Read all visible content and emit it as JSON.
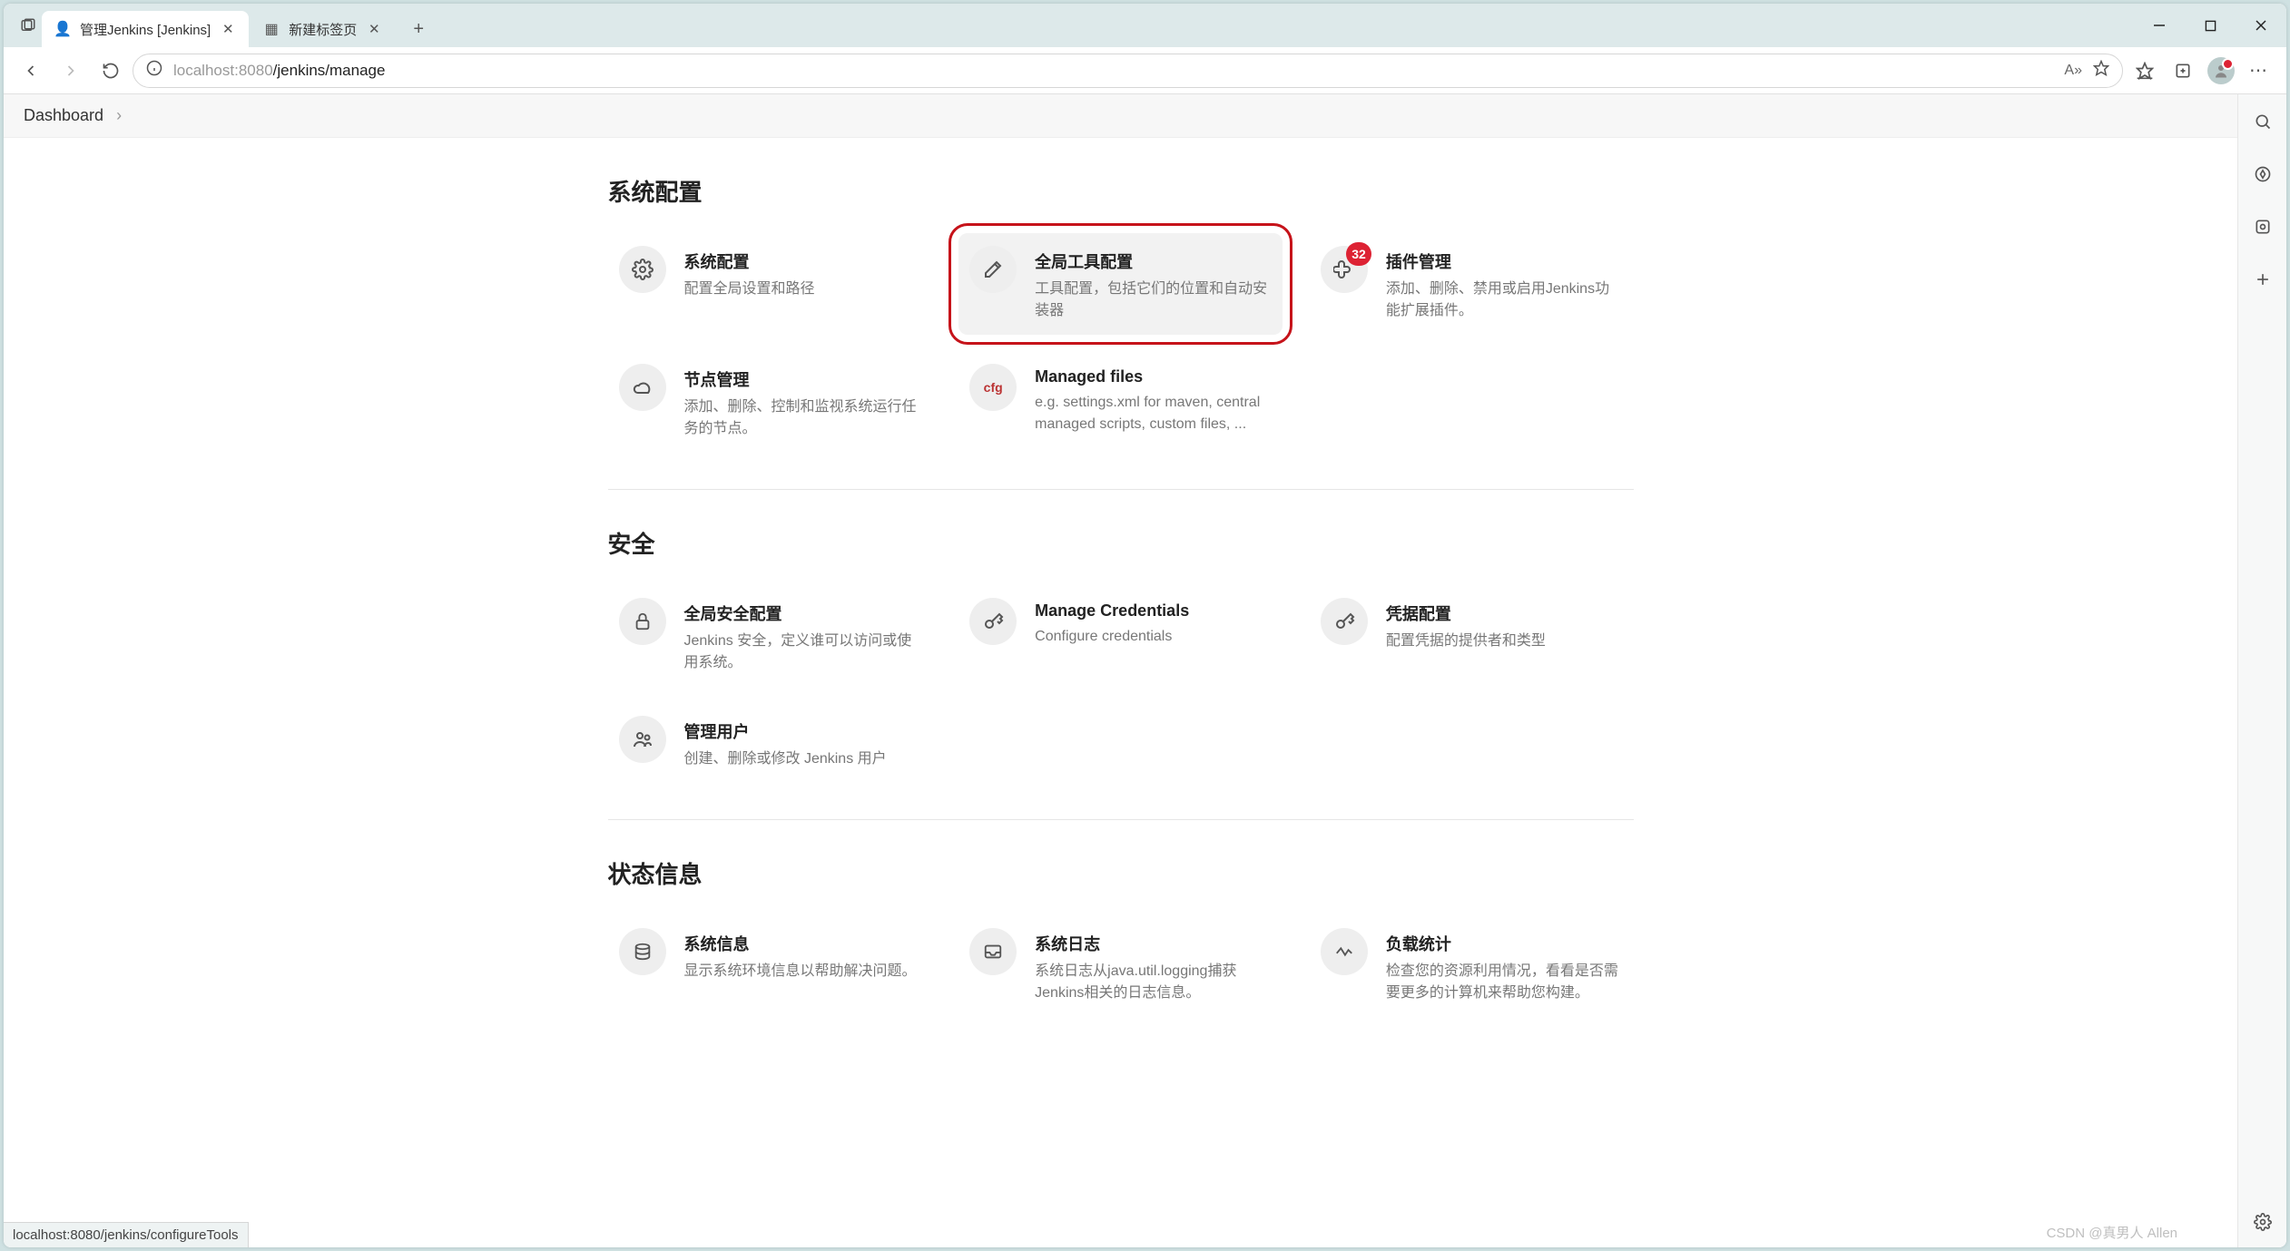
{
  "browser": {
    "tabs": [
      {
        "title": "管理Jenkins [Jenkins]",
        "active": true
      },
      {
        "title": "新建标签页",
        "active": false
      }
    ],
    "url_dim_left": "localhost",
    "url_dim_port": ":8080",
    "url_path": "/jenkins/manage",
    "aa_label": "A»",
    "status_url": "localhost:8080/jenkins/configureTools"
  },
  "breadcrumb": {
    "item": "Dashboard"
  },
  "sections": {
    "system": {
      "title": "系统配置",
      "cards": {
        "sys_conf": {
          "title": "系统配置",
          "desc": "配置全局设置和路径"
        },
        "tool_conf": {
          "title": "全局工具配置",
          "desc": "工具配置，包括它们的位置和自动安装器"
        },
        "plugins": {
          "title": "插件管理",
          "desc": "添加、删除、禁用或启用Jenkins功能扩展插件。",
          "badge": "32"
        },
        "nodes": {
          "title": "节点管理",
          "desc": "添加、删除、控制和监视系统运行任务的节点。"
        },
        "managed": {
          "title": "Managed files",
          "desc": "e.g. settings.xml for maven, central managed scripts, custom files, ..."
        }
      }
    },
    "security": {
      "title": "安全",
      "cards": {
        "global_sec": {
          "title": "全局安全配置",
          "desc": "Jenkins 安全，定义谁可以访问或使用系统。"
        },
        "credentials": {
          "title": "Manage Credentials",
          "desc": "Configure credentials"
        },
        "cred_conf": {
          "title": "凭据配置",
          "desc": "配置凭据的提供者和类型"
        },
        "users": {
          "title": "管理用户",
          "desc": "创建、删除或修改 Jenkins 用户"
        }
      }
    },
    "status": {
      "title": "状态信息",
      "cards": {
        "sysinfo": {
          "title": "系统信息",
          "desc": "显示系统环境信息以帮助解决问题。"
        },
        "syslog": {
          "title": "系统日志",
          "desc": "系统日志从java.util.logging捕获Jenkins相关的日志信息。"
        },
        "load": {
          "title": "负载统计",
          "desc": "检查您的资源利用情况，看看是否需要更多的计算机来帮助您构建。"
        }
      }
    }
  },
  "watermark": "CSDN @真男人 Allen"
}
